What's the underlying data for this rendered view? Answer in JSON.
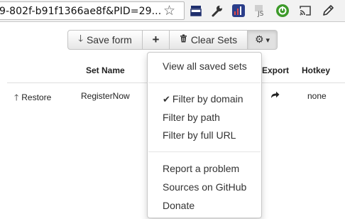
{
  "browser": {
    "url_text": "9-802f-b91f1366ae8f&PID=29..."
  },
  "toolbar": {
    "save_form": "Save form",
    "add_symbol": "+",
    "clear_sets": "Clear Sets",
    "settings_caret": "▾"
  },
  "table": {
    "headers": {
      "set_name": "Set Name",
      "export": "Export",
      "hotkey": "Hotkey"
    },
    "rows": [
      {
        "restore": "Restore",
        "set_name": "RegisterNow",
        "hotkey": "none"
      }
    ]
  },
  "menu": {
    "view_all": "View all saved sets",
    "filter_domain": "Filter by domain",
    "filter_path": "Filter by path",
    "filter_url": "Filter by full URL",
    "report": "Report a problem",
    "sources": "Sources on GitHub",
    "donate": "Donate",
    "checked_item": "filter_domain"
  },
  "colors": {
    "extension_green": "#3d9a2a",
    "menu_border": "#c8c8c8"
  }
}
